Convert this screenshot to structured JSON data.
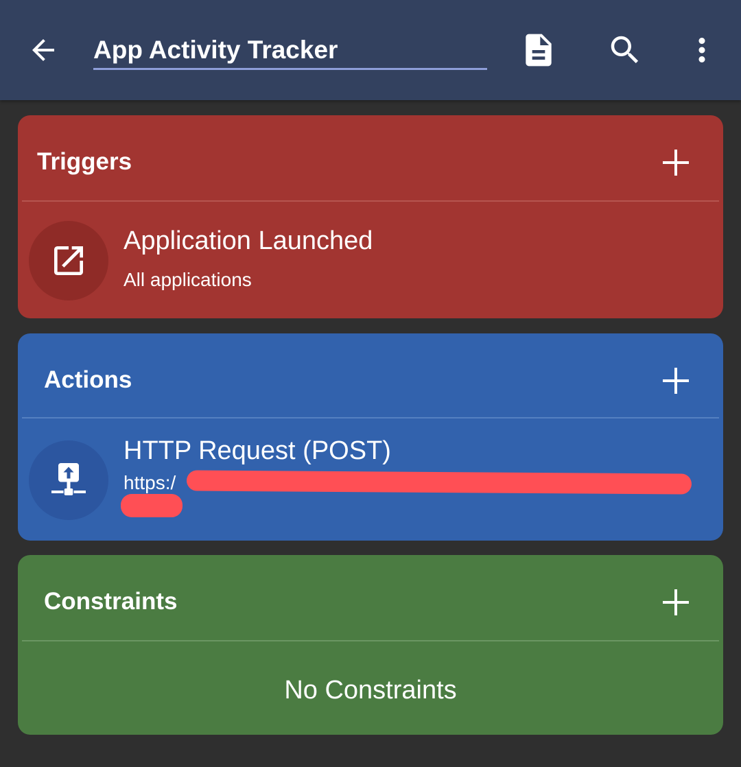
{
  "appbar": {
    "title_value": "App Activity Tracker",
    "icons": {
      "back": "arrow-back-icon",
      "doc": "document-icon",
      "search": "search-icon",
      "more": "more-vert-icon"
    }
  },
  "colors": {
    "appbar": "#33415f",
    "background": "#2f2f2f",
    "triggers": "#a23531",
    "triggers_icon_bg": "#8f2b27",
    "actions": "#3262ad",
    "actions_icon_bg": "#2c56a0",
    "constraints": "#4b7c42",
    "redaction": "#ff4f55"
  },
  "triggers": {
    "title": "Triggers",
    "items": [
      {
        "icon": "open-in-new-icon",
        "title": "Application Launched",
        "subtitle": "All applications"
      }
    ]
  },
  "actions": {
    "title": "Actions",
    "items": [
      {
        "icon": "network-upload-icon",
        "title": "HTTP Request (POST)",
        "subtitle_visible_prefix": "https:/"
      }
    ]
  },
  "constraints": {
    "title": "Constraints",
    "empty_text": "No Constraints"
  }
}
